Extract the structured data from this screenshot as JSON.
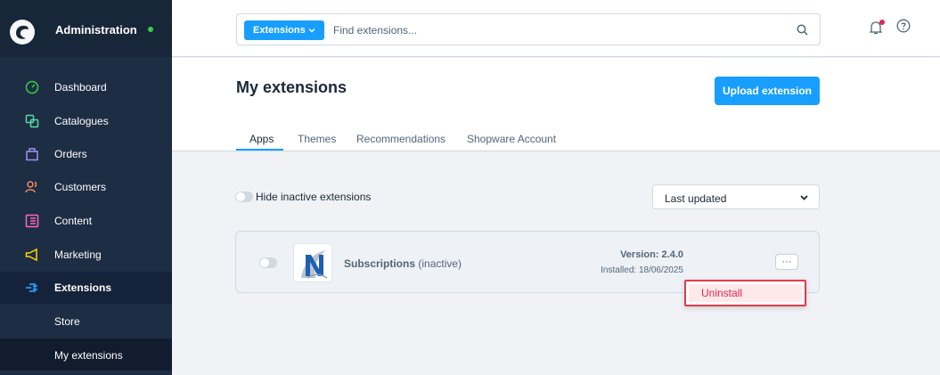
{
  "sidebar": {
    "title": "Administration",
    "items": [
      {
        "label": "Dashboard",
        "icon": "dashboard-icon",
        "color": "#37d046"
      },
      {
        "label": "Catalogues",
        "icon": "catalogues-icon",
        "color": "#57d9a3"
      },
      {
        "label": "Orders",
        "icon": "orders-icon",
        "color": "#a092f0"
      },
      {
        "label": "Customers",
        "icon": "customers-icon",
        "color": "#f88962"
      },
      {
        "label": "Content",
        "icon": "content-icon",
        "color": "#ff68b4"
      },
      {
        "label": "Marketing",
        "icon": "marketing-icon",
        "color": "#ffd700"
      },
      {
        "label": "Extensions",
        "icon": "extensions-icon",
        "color": "#189eff"
      }
    ],
    "subitems": [
      {
        "label": "Store"
      },
      {
        "label": "My extensions"
      }
    ]
  },
  "search": {
    "type_label": "Extensions",
    "placeholder": "Find extensions..."
  },
  "page": {
    "title": "My extensions",
    "upload_label": "Upload extension",
    "tabs": [
      {
        "label": "Apps"
      },
      {
        "label": "Themes"
      },
      {
        "label": "Recommendations"
      },
      {
        "label": "Shopware Account"
      }
    ]
  },
  "filters": {
    "hide_inactive_label": "Hide inactive extensions",
    "sort_value": "Last updated"
  },
  "extension": {
    "name": "Subscriptions",
    "status": "(inactive)",
    "version": "Version: 2.4.0",
    "installed": "Installed: 18/06/2025",
    "more_label": "···",
    "menu_item": "Uninstall"
  },
  "colors": {
    "accent": "#189eff",
    "sidebar_bg": "#1d2d44",
    "danger": "#de294c"
  }
}
